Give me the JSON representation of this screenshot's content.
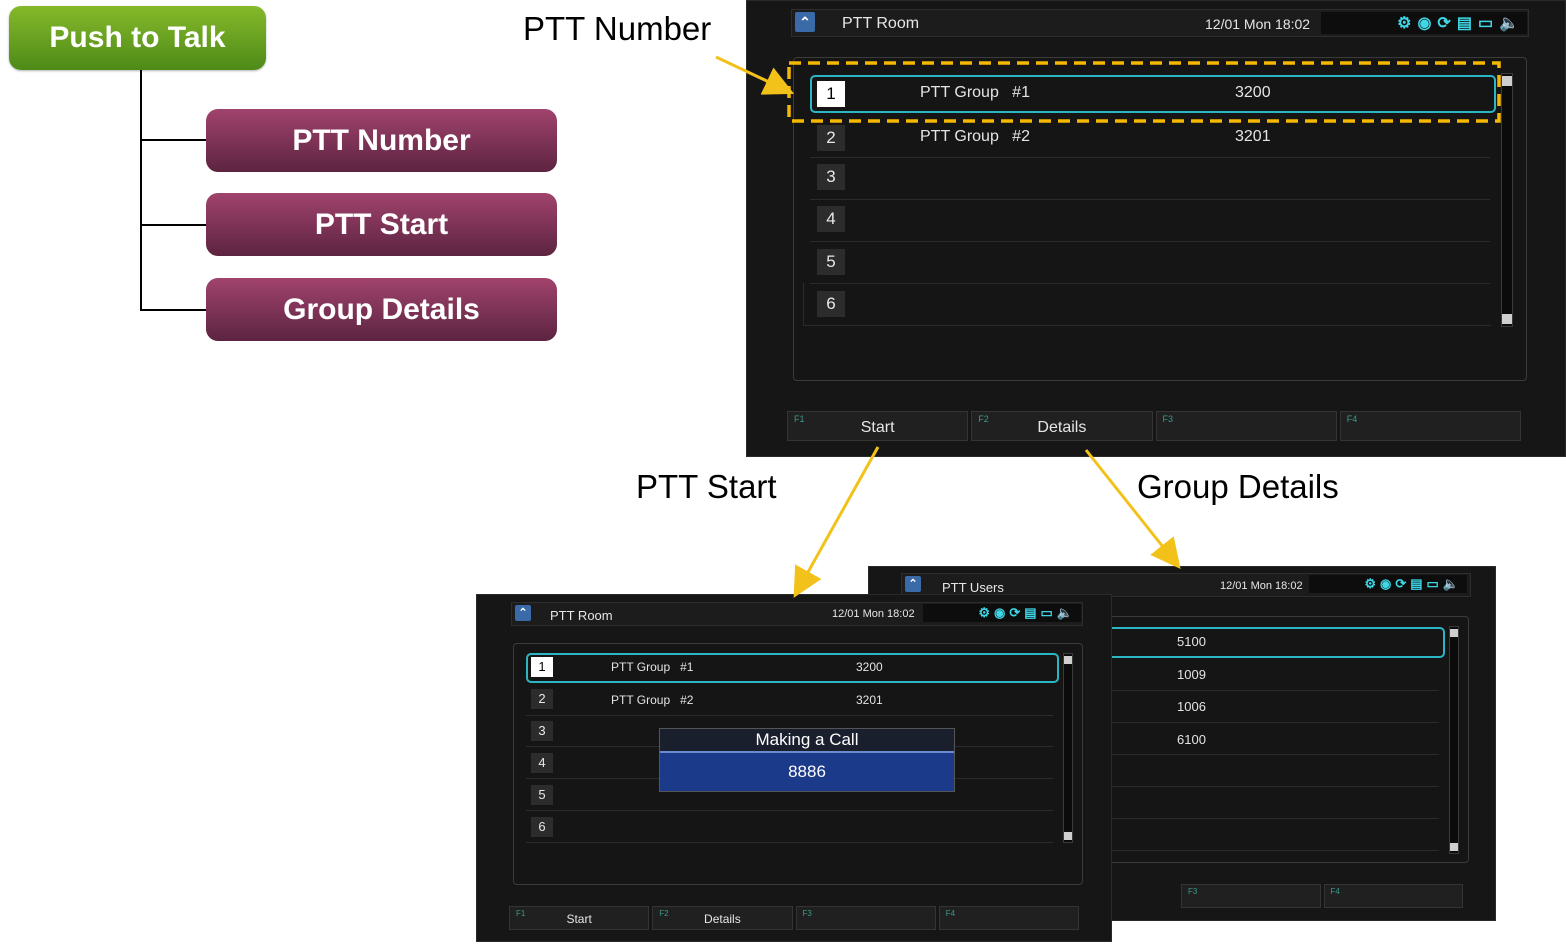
{
  "hierarchy": {
    "root": "Push to Talk",
    "children": [
      "PTT Number",
      "PTT Start",
      "Group Details"
    ]
  },
  "callouts": {
    "ptt_number": "PTT Number",
    "ptt_start": "PTT Start",
    "group_details": "Group Details"
  },
  "main_screen": {
    "title": "PTT Room",
    "datetime": "12/01 Mon 18:02",
    "rows": [
      {
        "index": "1",
        "name": "PTT Group   #1",
        "number": "3200"
      },
      {
        "index": "2",
        "name": "PTT Group   #2",
        "number": "3201"
      },
      {
        "index": "3",
        "name": "",
        "number": ""
      },
      {
        "index": "4",
        "name": "",
        "number": ""
      },
      {
        "index": "5",
        "name": "",
        "number": ""
      },
      {
        "index": "6",
        "name": "",
        "number": ""
      }
    ],
    "fkeys": [
      {
        "key": "F1",
        "label": "Start"
      },
      {
        "key": "F2",
        "label": "Details"
      },
      {
        "key": "F3",
        "label": ""
      },
      {
        "key": "F4",
        "label": ""
      }
    ]
  },
  "start_screen": {
    "title": "PTT Room",
    "datetime": "12/01 Mon 18:02",
    "rows": [
      {
        "index": "1",
        "name": "PTT Group   #1",
        "number": "3200"
      },
      {
        "index": "2",
        "name": "PTT Group   #2",
        "number": "3201"
      },
      {
        "index": "3",
        "name": "",
        "number": ""
      },
      {
        "index": "4",
        "name": "",
        "number": ""
      },
      {
        "index": "5",
        "name": "",
        "number": ""
      },
      {
        "index": "6",
        "name": "",
        "number": ""
      }
    ],
    "popup": {
      "title": "Making  a  Call",
      "number": "8886"
    },
    "fkeys": [
      {
        "key": "F1",
        "label": "Start"
      },
      {
        "key": "F2",
        "label": "Details"
      },
      {
        "key": "F3",
        "label": ""
      },
      {
        "key": "F4",
        "label": ""
      }
    ]
  },
  "users_screen": {
    "title": "PTT Users",
    "datetime": "12/01 Mon 18:02",
    "numbers": [
      "5100",
      "1009",
      "1006",
      "6100"
    ],
    "fkeys": [
      {
        "key": "F3",
        "label": ""
      },
      {
        "key": "F4",
        "label": ""
      }
    ]
  },
  "status_icons": [
    "gear-icon",
    "globe-icon",
    "sync-icon",
    "window-icon",
    "monitor-icon",
    "speaker-icon"
  ],
  "colors": {
    "root_green": "#6aa321",
    "child_purple": "#7d3356",
    "highlight_dash": "#f5b800",
    "arrow_yellow": "#f2c21b",
    "selection_teal": "#2ab6c2"
  }
}
